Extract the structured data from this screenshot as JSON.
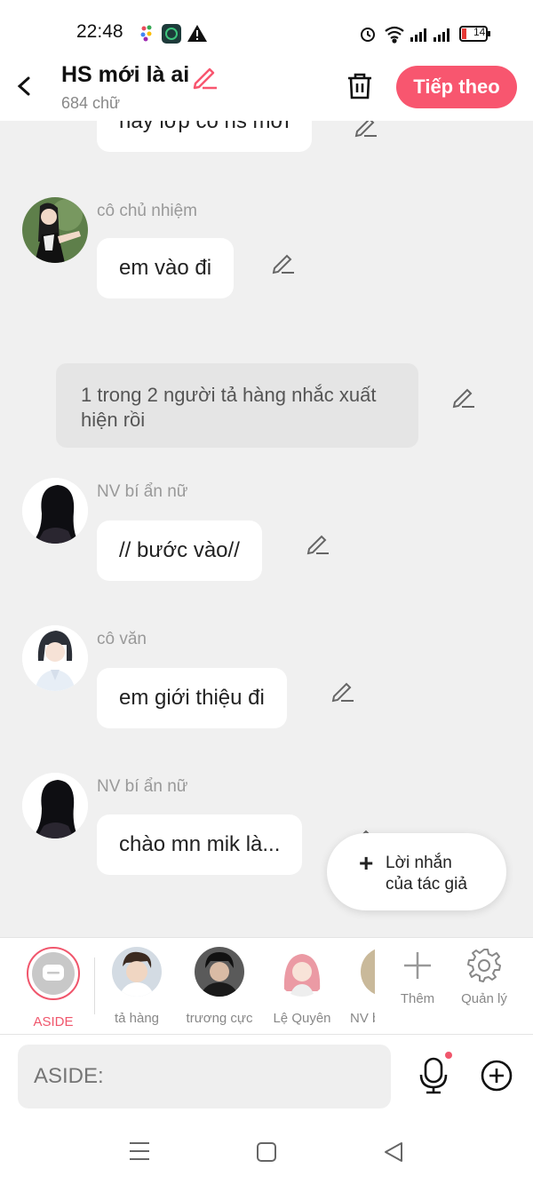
{
  "status": {
    "time": "22:48",
    "battery": "14"
  },
  "header": {
    "title": "HS mới là ai",
    "word_count": "684 chữ",
    "next_label": "Tiếp theo"
  },
  "chat": {
    "partial_bubble": "hay lớp có hs mới",
    "messages": [
      {
        "name": "cô chủ nhiệm",
        "text": "em vào đi"
      },
      {
        "name": "NV bí ẩn nữ",
        "text": "// bước vào//"
      },
      {
        "name": "cô văn",
        "text": "em giới thiệu đi"
      },
      {
        "name": "NV bí ẩn nữ",
        "text": "chào mn mik là..."
      }
    ],
    "narration": "1 trong 2 người tả hàng nhắc xuất hiện rồi"
  },
  "author_note": {
    "line1": "Lời nhắn",
    "line2": "của tác giả"
  },
  "characters": {
    "items": [
      {
        "label": "ASIDE"
      },
      {
        "label": "tả hàng"
      },
      {
        "label": "trương cực"
      },
      {
        "label": "Lệ Quyên"
      },
      {
        "label": "NV bí ẩn nữ"
      }
    ],
    "add_label": "Thêm",
    "manage_label": "Quản lý"
  },
  "input": {
    "placeholder": "ASIDE:"
  },
  "colors": {
    "accent": "#f8566f",
    "background": "#f0f0f0"
  }
}
